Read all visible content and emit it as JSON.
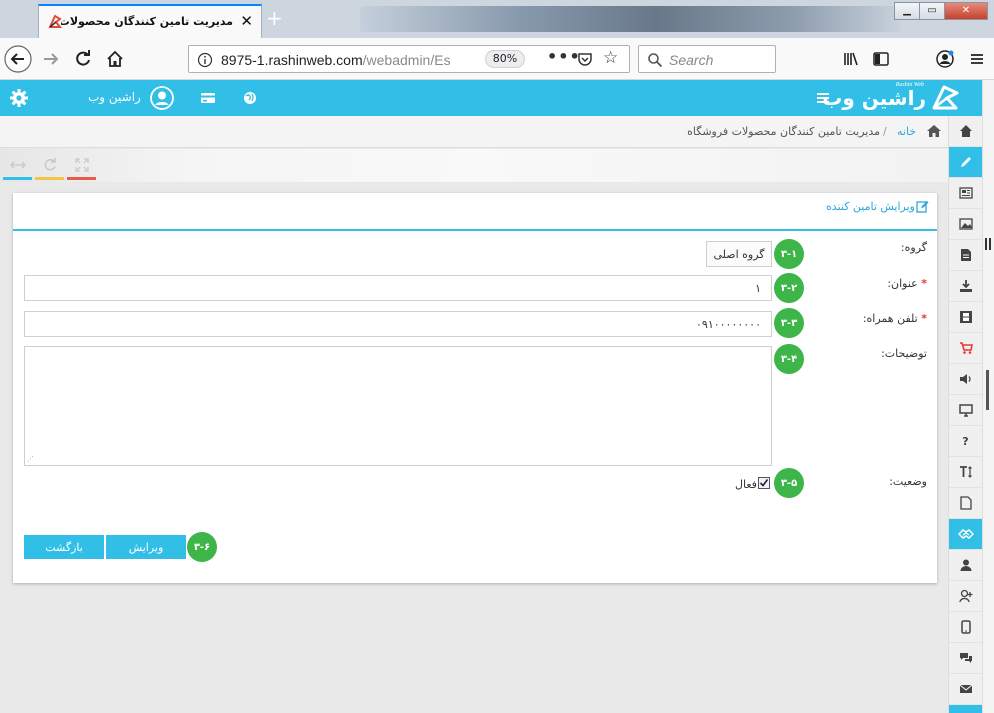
{
  "browser": {
    "tab_title": "مدیریت تامین کنندگان محصولات فرو",
    "url_host": "8975-1.rashinweb.com",
    "url_path": "/webadmin/Es",
    "zoom": "80%",
    "search_placeholder": "Search"
  },
  "header": {
    "brand_text": "راشین وب",
    "brand_latin": "Rashin Web",
    "user_name": "راشین وب"
  },
  "breadcrumb": {
    "home": "خانه",
    "separator": "/",
    "current": "مدیریت تامین کنندگان محصولات فروشگاه"
  },
  "panel": {
    "title": "ویرایش تامین کننده"
  },
  "form": {
    "group_label": "گروه:",
    "group_value": "گروه اصلی",
    "title_label": "عنوان:",
    "title_value": "۱",
    "phone_label": "تلفن همراه:",
    "phone_value": "۰۹۱۰۰۰۰۰۰۰۰",
    "desc_label": "توضیحات:",
    "desc_value": "",
    "status_label": "وضعیت:",
    "status_option": "فعال",
    "required_mark": "*"
  },
  "badges": [
    "۳-۱",
    "۳-۲",
    "۳-۳",
    "۳-۴",
    "۳-۵",
    "۳-۶"
  ],
  "buttons": {
    "edit": "ویرایش",
    "back": "بازگشت"
  },
  "colors": {
    "accent": "#32bfe7",
    "badge": "#3db548",
    "required": "#e53935"
  }
}
